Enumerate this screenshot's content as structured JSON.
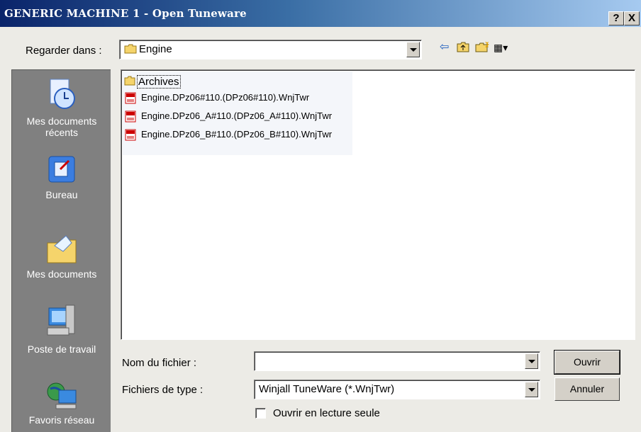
{
  "window": {
    "title": "GENERIC MACHINE 1 - Open Tuneware",
    "help_label": "?",
    "close_label": "X"
  },
  "lookin": {
    "label": "Regarder dans :",
    "value": "Engine"
  },
  "toolbar": {
    "back_glyph": "⇦",
    "up_glyph": "🖻",
    "newfolder_glyph": "✱",
    "views_glyph": "▦▾"
  },
  "places": [
    {
      "label": "Mes documents récents",
      "icon": "recent-documents-icon"
    },
    {
      "label": "Bureau",
      "icon": "desktop-icon"
    },
    {
      "label": "Mes documents",
      "icon": "my-documents-icon"
    },
    {
      "label": "Poste de travail",
      "icon": "my-computer-icon"
    },
    {
      "label": "Favoris réseau",
      "icon": "network-places-icon"
    }
  ],
  "files": [
    {
      "name": "Archives",
      "type": "folder"
    },
    {
      "name": "Engine.DPz06#110.(DPz06#110).WnjTwr",
      "type": "tuneware"
    },
    {
      "name": "Engine.DPz06_A#110.(DPz06_A#110).WnjTwr",
      "type": "tuneware"
    },
    {
      "name": "Engine.DPz06_B#110.(DPz06_B#110).WnjTwr",
      "type": "tuneware"
    }
  ],
  "filename": {
    "label": "Nom du fichier :",
    "value": ""
  },
  "filetype": {
    "label": "Fichiers de type :",
    "value": "Winjall TuneWare (*.WnjTwr)"
  },
  "readonly": {
    "label": "Ouvrir en lecture seule",
    "checked": false
  },
  "buttons": {
    "open": "Ouvrir",
    "cancel": "Annuler"
  },
  "colors": {
    "title_start": "#0a246a",
    "title_end": "#a6caf0",
    "places_bg": "#808080",
    "dialog_bg": "#ecebe6"
  }
}
